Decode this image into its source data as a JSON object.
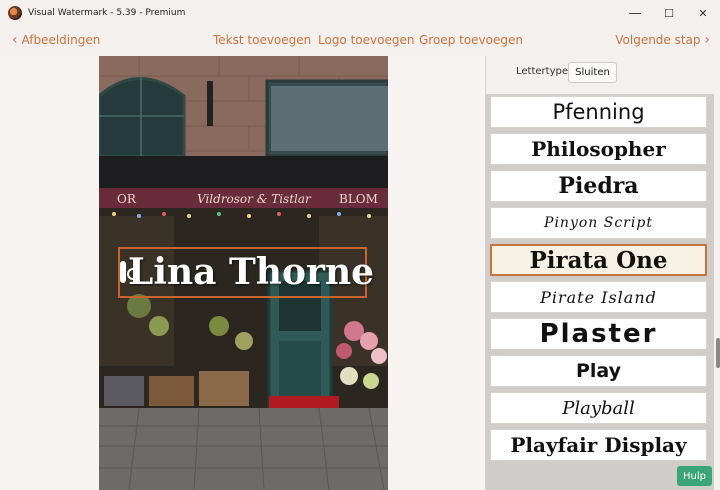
{
  "window": {
    "title": "Visual Watermark - 5.39 - Premium",
    "minimize": "—",
    "maximize": "☐",
    "close": "✕"
  },
  "nav": {
    "back": "Afbeeldingen",
    "add_text": "Tekst toevoegen",
    "add_logo": "Logo toevoegen",
    "add_group": "Groep toevoegen",
    "next": "Volgende stap"
  },
  "watermark": {
    "text": "Lina Thorne",
    "sign_text": "Vildrosor & Tistlar",
    "sign_left": "OR",
    "sign_right": "BLOM"
  },
  "panel": {
    "font_label": "Lettertype",
    "close_button": "Sluiten",
    "fonts": [
      {
        "name": "Pfenning",
        "selected": false
      },
      {
        "name": "Philosopher",
        "selected": false
      },
      {
        "name": "Piedra",
        "selected": false
      },
      {
        "name": "Pinyon Script",
        "selected": false
      },
      {
        "name": "Pirata One",
        "selected": true
      },
      {
        "name": "Pirate Island",
        "selected": false
      },
      {
        "name": "Plaster",
        "selected": false
      },
      {
        "name": "Play",
        "selected": false
      },
      {
        "name": "Playball",
        "selected": false
      },
      {
        "name": "Playfair Display",
        "selected": false
      }
    ]
  },
  "help": "Hulp",
  "colors": {
    "accent": "#c9743f",
    "help_green": "#3aa57a",
    "selection_bg": "#f7f1e3"
  }
}
